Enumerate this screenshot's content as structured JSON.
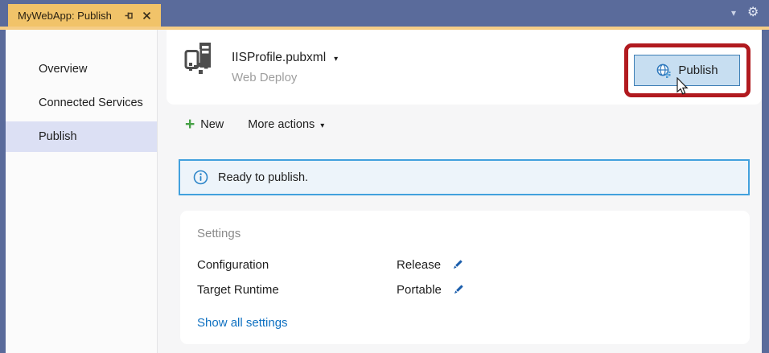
{
  "window": {
    "tab_title": "MyWebApp: Publish",
    "colors": {
      "titlebar_blue": "#5A6B9B",
      "active_tab_amber": "#F1C369",
      "accent_line": "#F5CD86",
      "sidebar_highlight": "#DCE0F4",
      "link_blue": "#0E70C1",
      "info_border": "#42A1DD",
      "info_background": "#EDF4FA",
      "button_background": "#C7DEF1",
      "button_border": "#3D7EB5",
      "annotation_red": "#B11A1F",
      "new_plus_green": "#46A046"
    }
  },
  "icons": {
    "gear": "⚙",
    "chevron_down": "▾",
    "dropdown_caret": "▾",
    "plus": "+"
  },
  "sidebar": {
    "items": [
      {
        "label": "Overview",
        "selected": false
      },
      {
        "label": "Connected Services",
        "selected": false
      },
      {
        "label": "Publish",
        "selected": true
      }
    ]
  },
  "header": {
    "profile_name": "IISProfile.pubxml",
    "profile_method": "Web Deploy",
    "publish_button_label": "Publish"
  },
  "toolbar": {
    "new_label": "New",
    "more_actions_label": "More actions"
  },
  "status": {
    "message": "Ready to publish."
  },
  "settings": {
    "title": "Settings",
    "rows": [
      {
        "label": "Configuration",
        "value": "Release"
      },
      {
        "label": "Target Runtime",
        "value": "Portable"
      }
    ],
    "link": "Show all settings"
  }
}
